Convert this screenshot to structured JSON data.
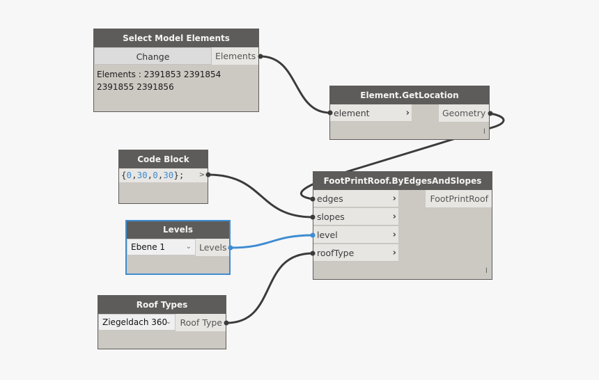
{
  "canvas": {
    "background": "#f7f7f7"
  },
  "colors": {
    "header": "#5e5c5a",
    "node_body": "#ccc8c2",
    "port_bg": "#e8e6e3",
    "wire": "#3b3b3b",
    "selected_wire": "#3e8cd2",
    "selected_border": "#3e8cd2"
  },
  "nodes": {
    "select_model_elements": {
      "title": "Select Model Elements",
      "button": "Change",
      "output": "Elements",
      "preview_line1": "Elements : 2391853 2391854",
      "preview_line2": "2391855 2391856"
    },
    "get_location": {
      "title": "Element.GetLocation",
      "input": "element",
      "output": "Geometry",
      "lacing": "l"
    },
    "code_block": {
      "title": "Code Block",
      "code_open": "{",
      "values": [
        "0",
        "30",
        "0",
        "30"
      ],
      "code_close": "};",
      "output": ">"
    },
    "footprint_roof": {
      "title": "FootPrintRoof.ByEdgesAndSlopes",
      "inputs": [
        "edges",
        "slopes",
        "level",
        "roofType"
      ],
      "output": "FootPrintRoof",
      "lacing": "l"
    },
    "levels": {
      "title": "Levels",
      "selected": "Ebene 1",
      "output": "Levels"
    },
    "roof_types": {
      "title": "Roof Types",
      "selected": "Ziegeldach 360",
      "output": "Roof Type"
    }
  },
  "icons": {
    "chevron": "›",
    "dropdown_caret": "⌄"
  }
}
